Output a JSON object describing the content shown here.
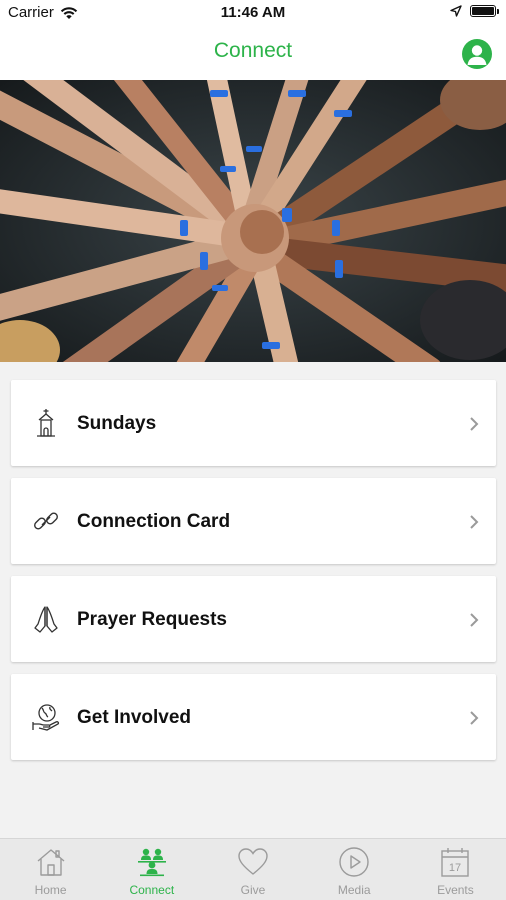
{
  "status_bar": {
    "carrier": "Carrier",
    "time": "11:46 AM"
  },
  "header": {
    "title": "Connect",
    "profile_icon": "person-icon"
  },
  "hero": {
    "image": "hands-stacked-together-photo"
  },
  "menu": {
    "items": [
      {
        "label": "Sundays",
        "icon": "church-icon"
      },
      {
        "label": "Connection Card",
        "icon": "link-icon"
      },
      {
        "label": "Prayer Requests",
        "icon": "praying-hands-icon"
      },
      {
        "label": "Get Involved",
        "icon": "globe-hand-icon"
      }
    ]
  },
  "tabs": [
    {
      "label": "Home",
      "icon": "house-icon",
      "active": false
    },
    {
      "label": "Connect",
      "icon": "people-icon",
      "active": true
    },
    {
      "label": "Give",
      "icon": "heart-icon",
      "active": false
    },
    {
      "label": "Media",
      "icon": "play-circle-icon",
      "active": false
    },
    {
      "label": "Events",
      "icon": "calendar-icon",
      "active": false
    }
  ],
  "calendar_day": "17",
  "colors": {
    "accent": "#2db34a",
    "tab_inactive": "#9b9b9b",
    "background": "#f2f2f2"
  }
}
